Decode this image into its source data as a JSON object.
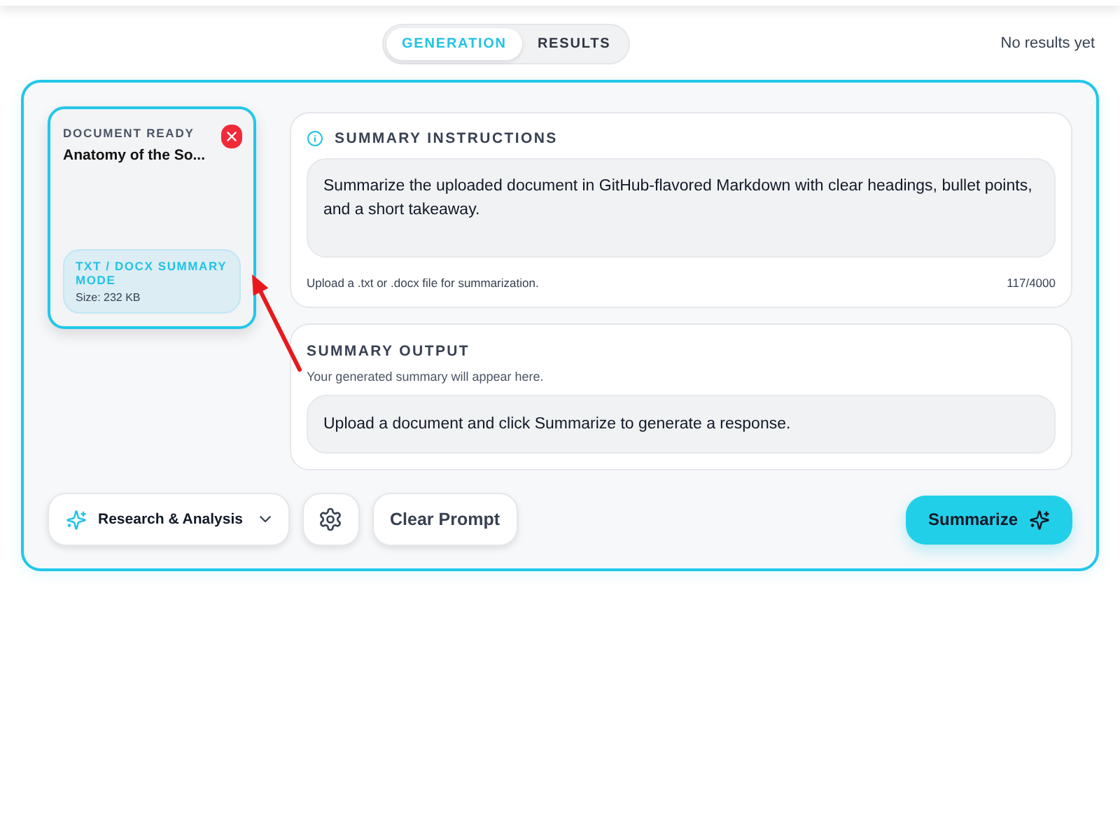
{
  "tabs": [
    {
      "label": "GENERATION",
      "selected": true
    },
    {
      "label": "RESULTS",
      "selected": false
    }
  ],
  "results_status": "No results yet",
  "document_card": {
    "status": "DOCUMENT READY",
    "title": "Anatomy of the So...",
    "mode": "TXT / DOCX SUMMARY MODE",
    "size": "Size: 232 KB"
  },
  "instructions": {
    "title": "SUMMARY INSTRUCTIONS",
    "value": "Summarize the uploaded document in GitHub-flavored Markdown with clear headings, bullet points, and a short takeaway.",
    "hint": "Upload a .txt or .docx file for summarization.",
    "count": "117/4000"
  },
  "output": {
    "title": "SUMMARY OUTPUT",
    "subtitle": "Your generated summary will appear here.",
    "message": "Upload a document and click Summarize to generate a response."
  },
  "toolbar": {
    "mode_dropdown": "Research & Analysis",
    "clear_button": "Clear Prompt",
    "submit_button": "Summarize"
  }
}
